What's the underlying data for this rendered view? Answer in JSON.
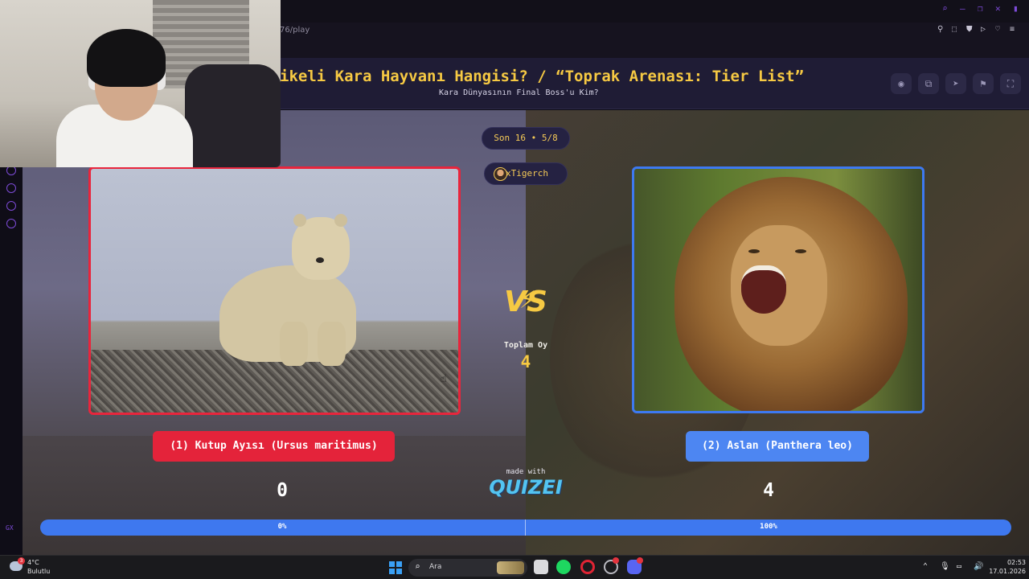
{
  "browser": {
    "url_partial": "76/play",
    "window_controls": [
      "search-icon",
      "minimize-icon",
      "restore-icon",
      "close-icon",
      "sidebar-icon"
    ],
    "extension_icons": [
      "pin-icon",
      "snapshot-icon",
      "shield-icon",
      "play-icon",
      "heart-icon",
      "menu-icon"
    ],
    "accent": "#7d4bd8"
  },
  "header": {
    "title": "ikeli Kara Hayvanı Hangisi? / “Toprak Arenası: Tier List”",
    "subtitle": "Kara Dünyasının Final Boss'u Kim?",
    "buttons": [
      "eye-icon",
      "copy-icon",
      "send-icon",
      "flag-icon",
      "fullscreen-icon"
    ]
  },
  "match": {
    "round_label": "Son 16 • 5/8",
    "username": "xTigerch",
    "vs_label": "VS",
    "total_label": "Toplam Oy",
    "total_votes": "4",
    "left": {
      "name": "(1) Kutup Ayısı (Ursus maritimus)",
      "votes": "0",
      "percent_label": "0%",
      "color": "#e4233a"
    },
    "right": {
      "name": "(2) Aslan (Panthera leo)",
      "votes": "4",
      "percent_label": "100%",
      "color": "#4d86f2"
    },
    "left_share": 0
  },
  "branding": {
    "made_with": "made with",
    "logo": "QUIZEI"
  },
  "taskbar": {
    "weather_temp": "4°C",
    "weather_desc": "Bulutlu",
    "weather_badge": "3",
    "search_placeholder": "Ara",
    "time": "02:53",
    "date": "17.01.2026",
    "apps": [
      "start-icon",
      "file-explorer-icon",
      "spotify-icon",
      "opera-gx-icon",
      "clock-icon",
      "discord-icon"
    ],
    "tray": [
      "chevron-up-icon",
      "microphone-icon",
      "display-icon",
      "volume-icon"
    ]
  }
}
